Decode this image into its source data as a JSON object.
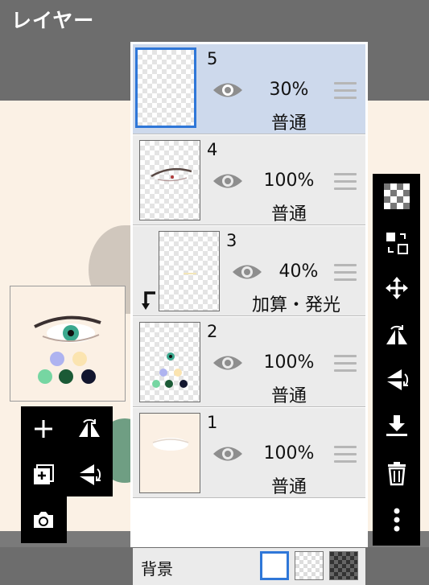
{
  "header": {
    "title": "レイヤー"
  },
  "layers": [
    {
      "number": "5",
      "opacity": "30%",
      "blend": "普通",
      "selected": true
    },
    {
      "number": "4",
      "opacity": "100%",
      "blend": "普通",
      "selected": false
    },
    {
      "number": "3",
      "opacity": "40%",
      "blend": "加算・発光",
      "clipped": true,
      "selected": false
    },
    {
      "number": "2",
      "opacity": "100%",
      "blend": "普通",
      "selected": false
    },
    {
      "number": "1",
      "opacity": "100%",
      "blend": "普通",
      "selected": false
    }
  ],
  "background": {
    "label": "背景",
    "options": [
      "white",
      "transparent",
      "dark-transparent"
    ],
    "selected": "white"
  },
  "right_toolbar": [
    "transparency-lock-icon",
    "swap-layer-icon",
    "move-icon",
    "flip-horizontal-icon",
    "flip-vertical-icon",
    "merge-down-icon",
    "trash-icon",
    "more-icon"
  ],
  "left_toolbar": [
    "add-layer-icon",
    "flip-horizontal-icon",
    "add-layer-copy-icon",
    "flip-vertical-icon",
    "camera-icon"
  ],
  "colors": {
    "selection": "#2f77d8",
    "selected_row": "#cdd9ec",
    "toolbar": "#000000"
  }
}
